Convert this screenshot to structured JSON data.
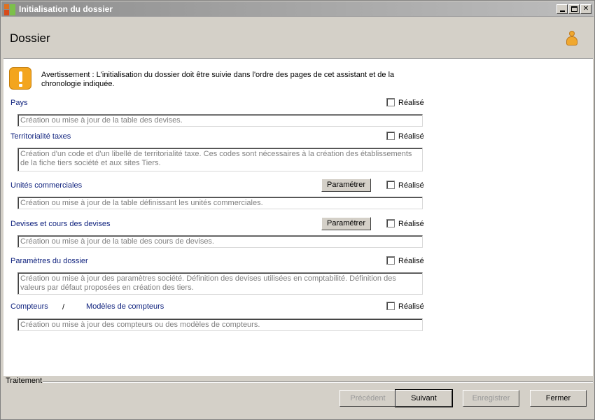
{
  "window": {
    "title": "Initialisation du dossier"
  },
  "header": {
    "title": "Dossier"
  },
  "warning": {
    "text": "Avertissement : L'initialisation du dossier doit être suivie dans l'ordre des pages de cet assistant et de la chronologie indiquée."
  },
  "sections": [
    {
      "label": "Pays",
      "description": "Création ou mise à jour de la table des devises.",
      "done_label": "Réalisé",
      "checked": false
    },
    {
      "label": "Territorialité taxes",
      "description": "Création d'un code et d'un libellé de territorialité taxe. Ces codes sont nécessaires à la création des établissements de la fiche tiers société et aux sites Tiers.",
      "done_label": "Réalisé",
      "checked": false
    },
    {
      "label": "Unités commerciales",
      "button_label": "Paramétrer",
      "description": "Création ou mise à jour de la table définissant les unités commerciales.",
      "done_label": "Réalisé",
      "checked": false
    },
    {
      "label": "Devises et cours des devises",
      "button_label": "Paramétrer",
      "description": "Création ou mise à jour de la table des cours de devises.",
      "done_label": "Réalisé",
      "checked": false
    },
    {
      "label": "Paramètres du dossier",
      "description": "Création ou mise à jour des paramètres société. Définition des devises utilisées en comptabilité. Définition des valeurs par défaut proposées en création des tiers.",
      "done_label": "Réalisé",
      "checked": false
    },
    {
      "label": "Compteurs",
      "separator": "/",
      "label2": "Modèles de compteurs",
      "description": "Création ou mise à jour des compteurs ou des modèles de compteurs.",
      "done_label": "Réalisé",
      "checked": false
    }
  ],
  "footer": {
    "group_label": "Traitement",
    "buttons": {
      "previous": "Précédent",
      "next": "Suivant",
      "save": "Enregistrer",
      "close": "Fermer"
    }
  },
  "colors": {
    "link": "#0c1f7c",
    "warning": "#f3a51e",
    "panel": "#d4d0c8"
  }
}
